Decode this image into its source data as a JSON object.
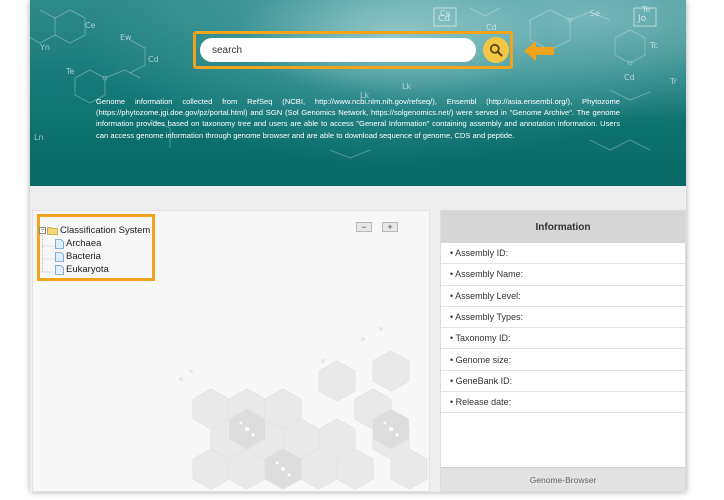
{
  "search": {
    "placeholder": "search"
  },
  "description": "Genome information collected from RefSeq (NCBI, http://www.ncbi.nlm.nih.gov/refseq/), Ensembl (http://asia.ensembl.org/), Phytozome (https://phytozome.jgi.doe.gov/pz/portal.html) and SGN (Sol Genomics Network, https://solgenomics.net/) were served in \"Genome Archive\". The genome information provides based on taxonomy tree and users are able to access \"General Information\" containing assembly and annotation information. Users can access genome information through genome browser and are able to download sequence of genome, CDS and peptide.",
  "zoom": {
    "minus": "−",
    "plus": "+"
  },
  "tree": {
    "root_label": "Classification System",
    "children": [
      "Archaea",
      "Bacteria",
      "Eukaryota"
    ]
  },
  "info": {
    "title": "Information",
    "fields": [
      "• Assembly ID:",
      "• Assembly Name:",
      "• Assembly Level:",
      "• Assembly Types:",
      "• Taxonomy ID:",
      "• Genome size:",
      "• GeneBank ID:",
      "• Release date:"
    ],
    "footer_button": "Genome-Browser"
  },
  "colors": {
    "highlight": "#f1a31b",
    "banner_teal": "#0b6f6c",
    "search_button": "#f3c644"
  },
  "icons": [
    "search-icon",
    "arrow-left-icon",
    "folder-icon",
    "file-icon",
    "expand-toggle-icon"
  ]
}
